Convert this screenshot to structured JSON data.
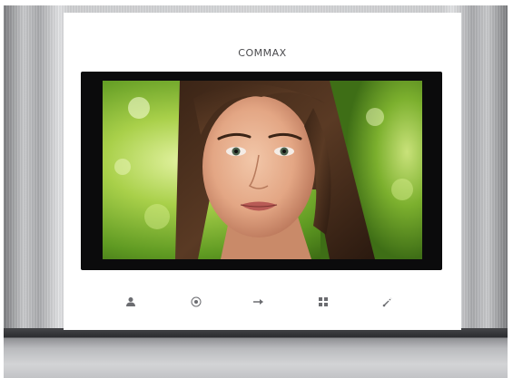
{
  "device": {
    "brand_text": "COMMAX"
  },
  "colors": {
    "panel": "#ffffff",
    "bezel": "#0b0b0c",
    "metal": "#d6d7d9",
    "button_icon": "#6b6c70"
  },
  "display": {
    "content": "video-feed-portrait"
  },
  "buttons": [
    {
      "icon": "person-icon"
    },
    {
      "icon": "monitor-icon"
    },
    {
      "icon": "door-open-icon"
    },
    {
      "icon": "menu-grid-icon"
    },
    {
      "icon": "phone-talk-icon"
    }
  ]
}
